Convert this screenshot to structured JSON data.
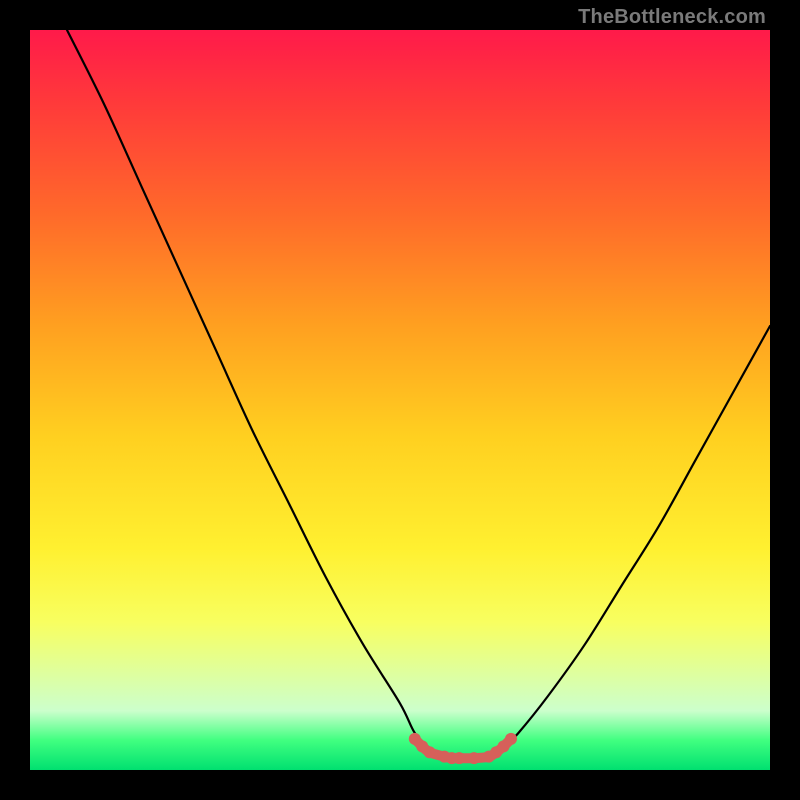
{
  "watermark": "TheBottleneck.com",
  "chart_data": {
    "type": "line",
    "title": "",
    "xlabel": "",
    "ylabel": "",
    "xlim": [
      0,
      100
    ],
    "ylim": [
      0,
      100
    ],
    "grid": false,
    "legend": false,
    "series": [
      {
        "name": "bottleneck-curve",
        "color": "#000000",
        "x": [
          5,
          10,
          15,
          20,
          25,
          30,
          35,
          40,
          45,
          50,
          52,
          54,
          57,
          60,
          62,
          64,
          66,
          70,
          75,
          80,
          85,
          90,
          95,
          100
        ],
        "values": [
          100,
          90,
          79,
          68,
          57,
          46,
          36,
          26,
          17,
          9,
          5,
          3,
          1.5,
          1.5,
          1.5,
          3,
          5,
          10,
          17,
          25,
          33,
          42,
          51,
          60
        ]
      },
      {
        "name": "bottom-highlight",
        "color": "#d6605a",
        "x": [
          52,
          53,
          54,
          56,
          57,
          58,
          60,
          62,
          63,
          64,
          65
        ],
        "values": [
          4.2,
          3.2,
          2.4,
          1.8,
          1.6,
          1.6,
          1.6,
          1.8,
          2.4,
          3.2,
          4.2
        ]
      }
    ],
    "annotations": []
  }
}
